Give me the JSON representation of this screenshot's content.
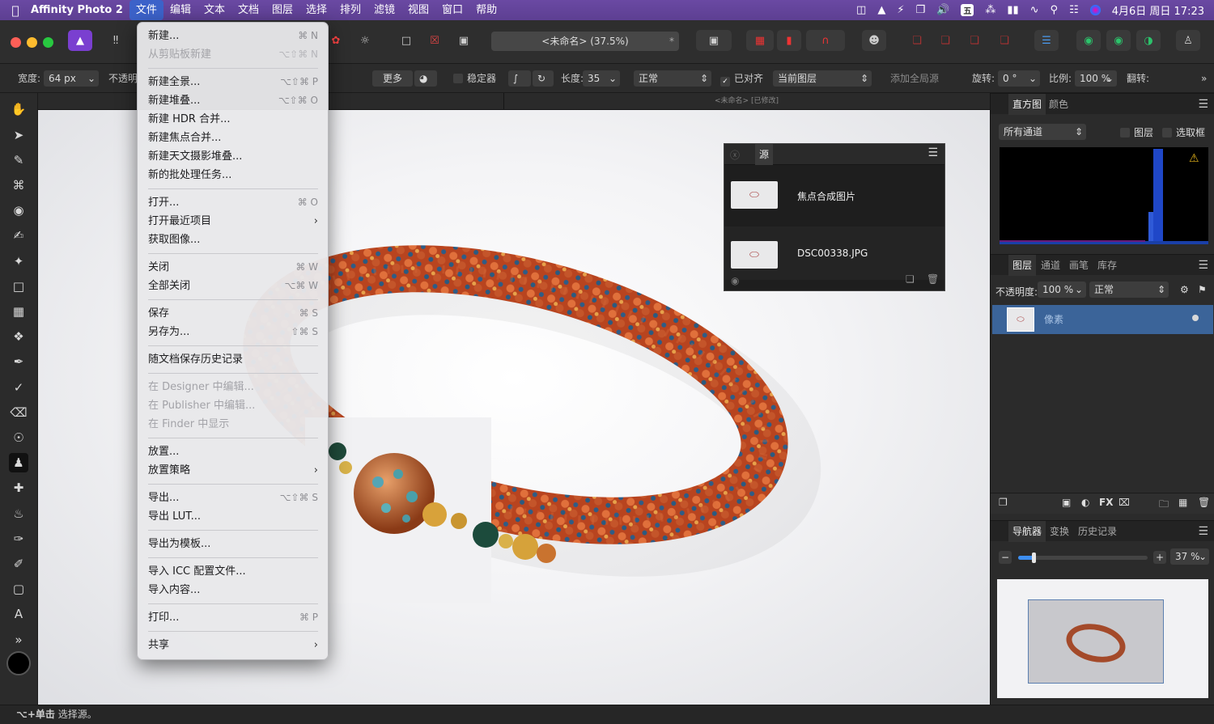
{
  "menubar": {
    "app_name": "Affinity Photo 2",
    "items": [
      "文件",
      "编辑",
      "文本",
      "文档",
      "图层",
      "选择",
      "排列",
      "滤镜",
      "视图",
      "窗口",
      "帮助"
    ],
    "input_method": "五",
    "datetime": "4月6日 周日 17:23"
  },
  "toolbar": {
    "doc_title": "<未命名> (37.5%)",
    "star": "*"
  },
  "context": {
    "width_label": "宽度:",
    "width_value": "64 px",
    "opacity_label": "不透明",
    "more_label": "更多",
    "stabilizer_label": "稳定器",
    "length_label": "长度:",
    "length_value": "35",
    "blend_mode": "正常",
    "aligned_label": "已对齐",
    "source_layer": "当前图层",
    "add_global_source": "添加全局源",
    "rotate_label": "旋转:",
    "rotate_value": "0 °",
    "scale_label": "比例:",
    "scale_value": "100 %",
    "flip_label": "翻转:"
  },
  "canvas": {
    "tab_label": "<未命名> [已修改]"
  },
  "file_menu": {
    "items": [
      {
        "label": "新建...",
        "shortcut": "⌘ N",
        "disabled": false,
        "submenu": false
      },
      {
        "label": "从剪贴板新建",
        "shortcut": "⌥⇧⌘ N",
        "disabled": true,
        "submenu": false
      },
      {
        "separator": true
      },
      {
        "label": "新建全景...",
        "shortcut": "⌥⇧⌘ P",
        "disabled": false,
        "submenu": false
      },
      {
        "label": "新建堆叠...",
        "shortcut": "⌥⇧⌘ O",
        "disabled": false,
        "submenu": false
      },
      {
        "label": "新建 HDR 合并...",
        "shortcut": "",
        "disabled": false,
        "submenu": false
      },
      {
        "label": "新建焦点合并...",
        "shortcut": "",
        "disabled": false,
        "submenu": false
      },
      {
        "label": "新建天文摄影堆叠...",
        "shortcut": "",
        "disabled": false,
        "submenu": false
      },
      {
        "label": "新的批处理任务...",
        "shortcut": "",
        "disabled": false,
        "submenu": false
      },
      {
        "separator": true
      },
      {
        "label": "打开...",
        "shortcut": "⌘ O",
        "disabled": false,
        "submenu": false
      },
      {
        "label": "打开最近项目",
        "shortcut": "",
        "disabled": false,
        "submenu": true
      },
      {
        "label": "获取图像...",
        "shortcut": "",
        "disabled": false,
        "submenu": false
      },
      {
        "separator": true
      },
      {
        "label": "关闭",
        "shortcut": "⌘ W",
        "disabled": false,
        "submenu": false
      },
      {
        "label": "全部关闭",
        "shortcut": "⌥⌘ W",
        "disabled": false,
        "submenu": false
      },
      {
        "separator": true
      },
      {
        "label": "保存",
        "shortcut": "⌘ S",
        "disabled": false,
        "submenu": false
      },
      {
        "label": "另存为...",
        "shortcut": "⇧⌘ S",
        "disabled": false,
        "submenu": false
      },
      {
        "separator": true
      },
      {
        "label": "随文档保存历史记录",
        "shortcut": "",
        "disabled": false,
        "submenu": false
      },
      {
        "separator": true
      },
      {
        "label": "在 Designer 中编辑...",
        "shortcut": "",
        "disabled": true,
        "submenu": false
      },
      {
        "label": "在 Publisher 中编辑...",
        "shortcut": "",
        "disabled": true,
        "submenu": false
      },
      {
        "label": "在 Finder 中显示",
        "shortcut": "",
        "disabled": true,
        "submenu": false
      },
      {
        "separator": true
      },
      {
        "label": "放置...",
        "shortcut": "",
        "disabled": false,
        "submenu": false
      },
      {
        "label": "放置策略",
        "shortcut": "",
        "disabled": false,
        "submenu": true
      },
      {
        "separator": true
      },
      {
        "label": "导出...",
        "shortcut": "⌥⇧⌘ S",
        "disabled": false,
        "submenu": false
      },
      {
        "label": "导出 LUT...",
        "shortcut": "",
        "disabled": false,
        "submenu": false
      },
      {
        "separator": true
      },
      {
        "label": "导出为模板...",
        "shortcut": "",
        "disabled": false,
        "submenu": false
      },
      {
        "separator": true
      },
      {
        "label": "导入 ICC 配置文件...",
        "shortcut": "",
        "disabled": false,
        "submenu": false
      },
      {
        "label": "导入内容...",
        "shortcut": "",
        "disabled": false,
        "submenu": false
      },
      {
        "separator": true
      },
      {
        "label": "打印...",
        "shortcut": "⌘ P",
        "disabled": false,
        "submenu": false
      },
      {
        "separator": true
      },
      {
        "label": "共享",
        "shortcut": "",
        "disabled": false,
        "submenu": true
      }
    ]
  },
  "source_panel": {
    "title": "源",
    "items": [
      {
        "name": "焦点合成图片"
      },
      {
        "name": "DSC00338.JPG"
      }
    ]
  },
  "histogram_panel": {
    "tabs": [
      "直方图",
      "颜色"
    ],
    "channel": "所有通道",
    "layer_label": "图层",
    "marquee_label": "选取框"
  },
  "layers_panel": {
    "tabs": [
      "图层",
      "通道",
      "画笔",
      "库存"
    ],
    "opacity_label": "不透明度:",
    "opacity_value": "100 %",
    "blend_mode": "正常",
    "layer_name": "像素"
  },
  "navigator_panel": {
    "tabs": [
      "导航器",
      "变换",
      "历史记录"
    ],
    "zoom_value": "37 %",
    "zoom_level": 0.12
  },
  "statusbar": {
    "modifier": "⌥+单击",
    "text": "选择源。"
  }
}
